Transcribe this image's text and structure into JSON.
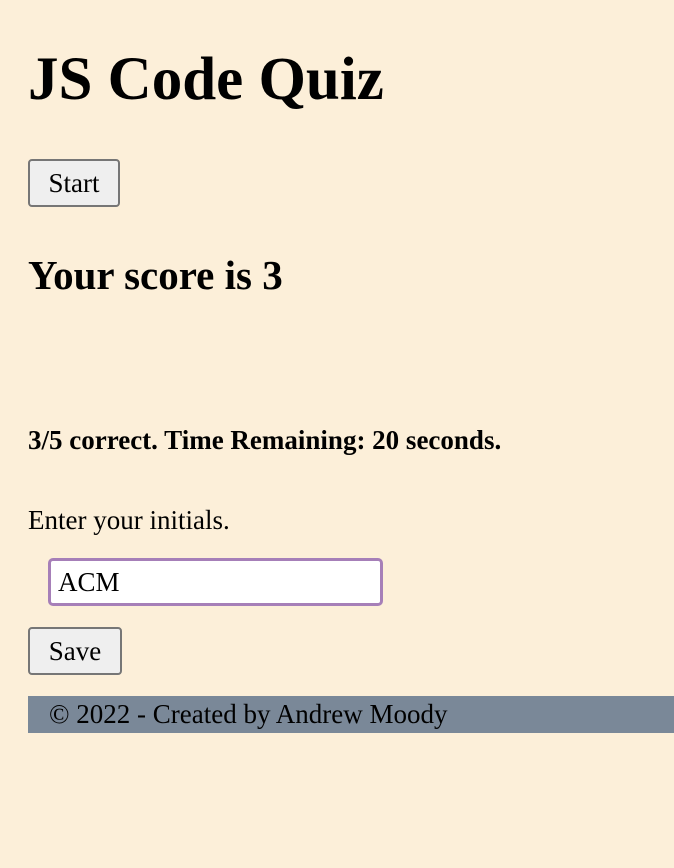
{
  "header": {
    "title": "JS Code Quiz"
  },
  "controls": {
    "start_label": "Start",
    "save_label": "Save"
  },
  "results": {
    "score_text": "Your score is 3",
    "summary_text": "3/5 correct. Time Remaining: 20 seconds."
  },
  "form": {
    "prompt": "Enter your initials.",
    "initials_value": "ACM"
  },
  "footer": {
    "text": "© 2022 - Created by Andrew Moody"
  },
  "colors": {
    "background": "#fcefd9",
    "footer_background": "#7a8898",
    "input_focus_border": "#a67fb8"
  }
}
